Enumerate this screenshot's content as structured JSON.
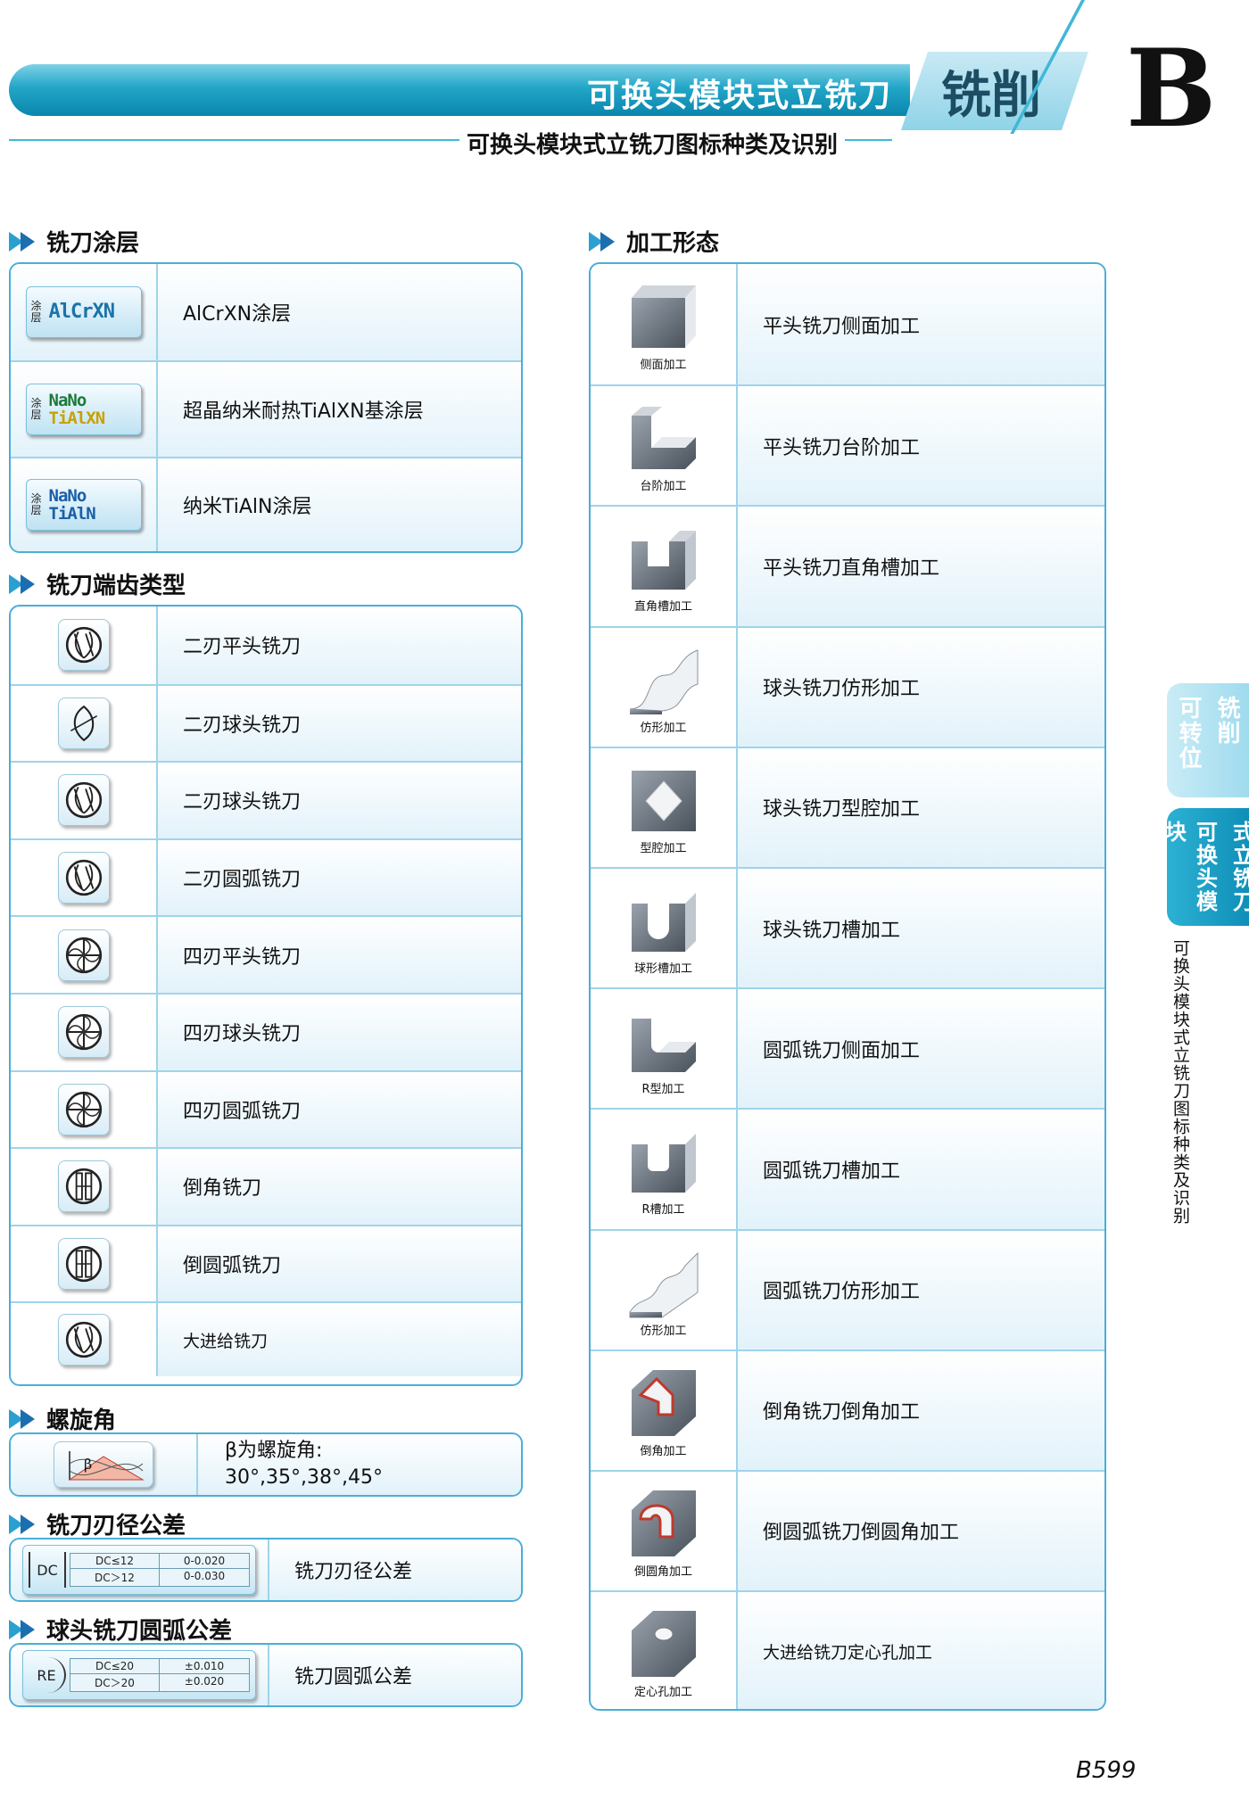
{
  "header": {
    "title": "可换头模块式立铣刀",
    "tab": "铣削",
    "letter": "B",
    "subtitle": "可换头模块式立铣刀图标种类及识别"
  },
  "coating": {
    "title": "铣刀涂层",
    "items": [
      {
        "icon_label": "涂层",
        "icon_text": "AlCrXN",
        "desc": "AlCrXN涂层"
      },
      {
        "icon_label": "涂层",
        "icon_text1": "NaNo",
        "icon_text2": "TiAlXN",
        "desc": "超晶纳米耐热TiAlXN基涂层"
      },
      {
        "icon_label": "涂层",
        "icon_text1": "NaNo",
        "icon_text2": "TiAlN",
        "desc": "纳米TiAlN涂层"
      }
    ]
  },
  "teeth": {
    "title": "铣刀端齿类型",
    "items": [
      {
        "icon": "two-flute-flat-icon",
        "desc": "二刃平头铣刀"
      },
      {
        "icon": "two-flute-ball-icon",
        "desc": "二刃球头铣刀"
      },
      {
        "icon": "two-flute-ball-alt-icon",
        "desc": "二刃球头铣刀"
      },
      {
        "icon": "two-flute-radius-icon",
        "desc": "二刃圆弧铣刀"
      },
      {
        "icon": "four-flute-flat-icon",
        "desc": "四刃平头铣刀"
      },
      {
        "icon": "four-flute-ball-icon",
        "desc": "四刃球头铣刀"
      },
      {
        "icon": "four-flute-radius-icon",
        "desc": "四刃圆弧铣刀"
      },
      {
        "icon": "chamfer-cutter-icon",
        "desc": "倒角铣刀"
      },
      {
        "icon": "corner-round-cutter-icon",
        "desc": "倒圆弧铣刀"
      },
      {
        "icon": "high-feed-cutter-icon",
        "desc": "大进给铣刀"
      }
    ]
  },
  "helix": {
    "title": "螺旋角",
    "symbol": "β",
    "line1": "β为螺旋角:",
    "line2": "30°,35°,38°,45°"
  },
  "dia_tol": {
    "title": "铣刀刃径公差",
    "key": "DC",
    "r1c1": "DC≤12",
    "r1c2": "0-0.020",
    "r2c1": "DC＞12",
    "r2c2": "0-0.030",
    "desc": "铣刀刃径公差"
  },
  "ball_tol": {
    "title": "球头铣刀圆弧公差",
    "key": "RE",
    "r1c1": "DC≤20",
    "r1c2": "±0.010",
    "r2c1": "DC＞20",
    "r2c2": "±0.020",
    "desc": "铣刀圆弧公差"
  },
  "machining": {
    "title": "加工形态",
    "items": [
      {
        "icon": "side-milling-icon",
        "label": "侧面加工",
        "desc": "平头铣刀侧面加工"
      },
      {
        "icon": "shoulder-milling-icon",
        "label": "台阶加工",
        "desc": "平头铣刀台阶加工"
      },
      {
        "icon": "square-slot-icon",
        "label": "直角槽加工",
        "desc": "平头铣刀直角槽加工"
      },
      {
        "icon": "profiling-icon",
        "label": "仿形加工",
        "desc": "球头铣刀仿形加工"
      },
      {
        "icon": "cavity-icon",
        "label": "型腔加工",
        "desc": "球头铣刀型腔加工"
      },
      {
        "icon": "ball-slot-icon",
        "label": "球形槽加工",
        "desc": "球头铣刀槽加工"
      },
      {
        "icon": "r-shape-icon",
        "label": "R型加工",
        "desc": "圆弧铣刀侧面加工"
      },
      {
        "icon": "r-slot-icon",
        "label": "R槽加工",
        "desc": "圆弧铣刀槽加工"
      },
      {
        "icon": "profiling-wave-icon",
        "label": "仿形加工",
        "desc": "圆弧铣刀仿形加工"
      },
      {
        "icon": "chamfer-icon",
        "label": "倒角加工",
        "desc": "倒角铣刀倒角加工"
      },
      {
        "icon": "corner-round-icon",
        "label": "倒圆角加工",
        "desc": "倒圆弧铣刀倒圆角加工"
      },
      {
        "icon": "center-hole-icon",
        "label": "定心孔加工",
        "desc": "大进给铣刀定心孔加工"
      }
    ]
  },
  "side_tabs": {
    "tab1_a": "铣削",
    "tab1_b": "可转位",
    "tab2_a": "式立铣刀",
    "tab2_b": "可换头模块",
    "sub": "可换头模块式立铣刀图标种类及识别"
  },
  "page_number": "B599"
}
